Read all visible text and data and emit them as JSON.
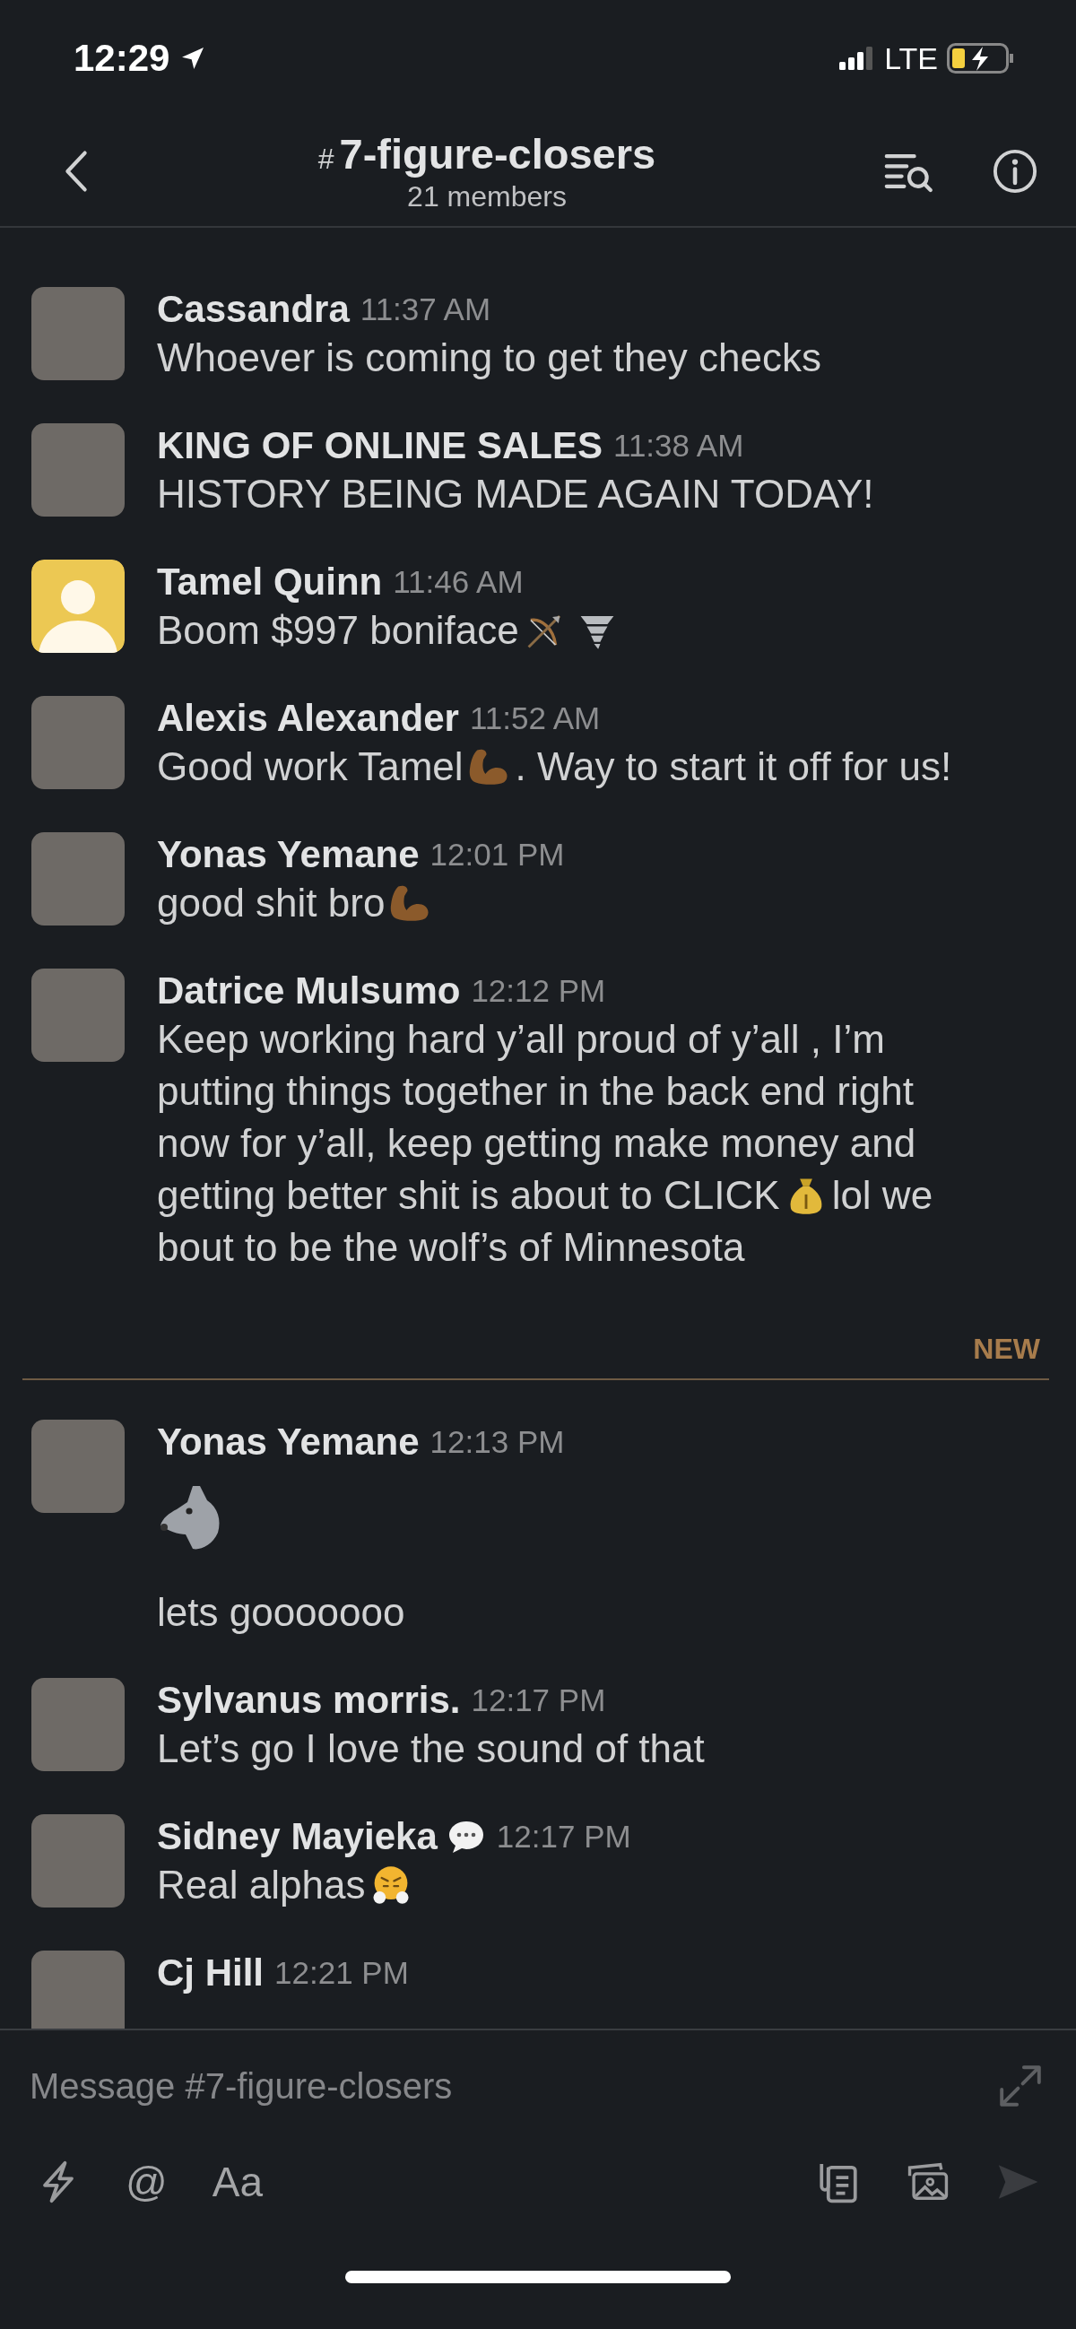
{
  "status_bar": {
    "time": "12:29",
    "network": "LTE"
  },
  "header": {
    "channel_prefix": "#",
    "channel": "7-figure-closers",
    "members": "21 members"
  },
  "messages": [
    {
      "kind": "message",
      "author": "Cassandra",
      "time": "11:37 AM",
      "lines": [
        [
          {
            "kind": "text",
            "text": "Whoever is coming to get they checks"
          }
        ]
      ]
    },
    {
      "kind": "message",
      "author": "KING OF ONLINE SALES",
      "time": "11:38 AM",
      "lines": [
        [
          {
            "kind": "text",
            "text": "HISTORY BEING MADE AGAIN TODAY!"
          }
        ]
      ]
    },
    {
      "kind": "message",
      "author": "Tamel Quinn",
      "default_avatar": true,
      "time": "11:46 AM",
      "lines": [
        [
          {
            "kind": "text",
            "text": "Boom $997 boniface"
          },
          {
            "kind": "bow"
          },
          {
            "kind": "tornado"
          }
        ]
      ]
    },
    {
      "kind": "message",
      "author": "Alexis Alexander",
      "time": "11:52 AM",
      "lines": [
        [
          {
            "kind": "text",
            "text": "Good work Tamel"
          },
          {
            "kind": "biceps"
          },
          {
            "kind": "text",
            "text": ". Way to start it off for us!"
          }
        ]
      ]
    },
    {
      "kind": "message",
      "author": "Yonas Yemane",
      "time": "12:01 PM",
      "lines": [
        [
          {
            "kind": "text",
            "text": "good shit bro"
          },
          {
            "kind": "biceps"
          }
        ]
      ]
    },
    {
      "kind": "message",
      "author": "Datrice Mulsumo",
      "time": "12:12 PM",
      "lines": [
        [
          {
            "kind": "text",
            "text": "Keep working hard y’all proud of y’all , I’m"
          }
        ],
        [
          {
            "kind": "text",
            "text": "putting things together in the back end right"
          }
        ],
        [
          {
            "kind": "text",
            "text": "now for y’all, keep getting make money and"
          }
        ],
        [
          {
            "kind": "text",
            "text": "getting better shit is about to CLICK"
          },
          {
            "kind": "moneybag"
          },
          {
            "kind": "text",
            "text": "lol we"
          }
        ],
        [
          {
            "kind": "text",
            "text": "bout to be the wolf’s of Minnesota"
          }
        ]
      ]
    },
    {
      "kind": "divider",
      "label": "NEW"
    },
    {
      "kind": "message",
      "author": "Yonas Yemane",
      "time": "12:13 PM",
      "lines": [
        [
          {
            "kind": "wolf"
          }
        ],
        [
          {
            "kind": "text",
            "text": "lets gooooooo"
          }
        ]
      ]
    },
    {
      "kind": "message",
      "author": "Sylvanus morris.",
      "time": "12:17 PM",
      "lines": [
        [
          {
            "kind": "text",
            "text": "Let’s go I love the sound of that"
          }
        ]
      ]
    },
    {
      "kind": "message",
      "author": "Sidney Mayieka",
      "has_status": true,
      "time": "12:17 PM",
      "lines": [
        [
          {
            "kind": "text",
            "text": "Real alphas"
          },
          {
            "kind": "steam"
          }
        ]
      ]
    },
    {
      "kind": "message",
      "author": "Cj Hill",
      "time": "12:21 PM"
    }
  ],
  "composer": {
    "placeholder": "Message #7-figure-closers",
    "mention": "@",
    "format": "Aa",
    "send_disabled": true
  }
}
